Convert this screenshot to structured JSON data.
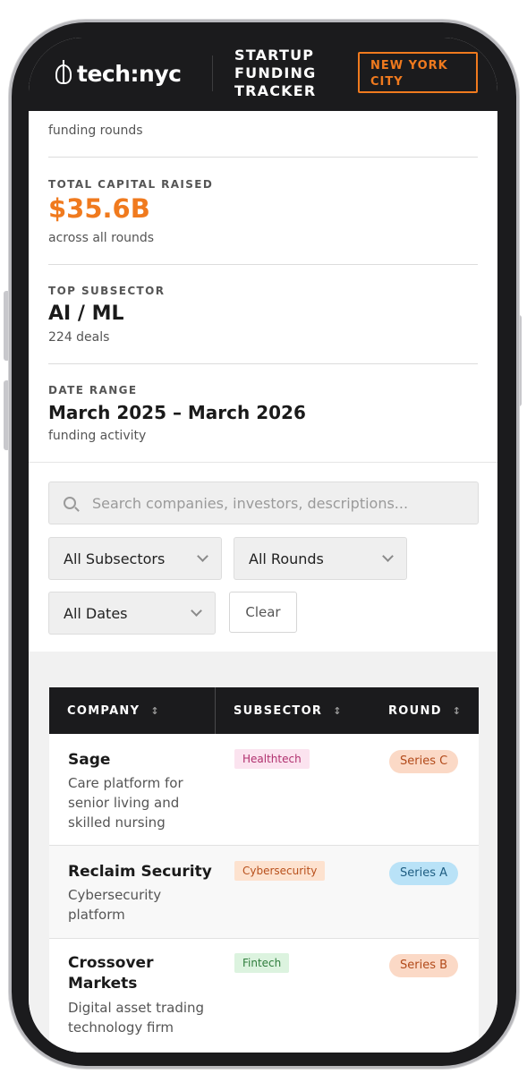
{
  "header": {
    "logo_text": "tech:nyc",
    "title": "STARTUP FUNDING TRACKER",
    "city": "NEW YORK CITY"
  },
  "stats": {
    "rounds": {
      "sub": "funding rounds"
    },
    "capital": {
      "label": "TOTAL CAPITAL RAISED",
      "value": "$35.6B",
      "sub": "across all rounds",
      "color": "#f07a1e"
    },
    "subsector": {
      "label": "TOP SUBSECTOR",
      "value": "AI / ML",
      "sub": "224 deals"
    },
    "dates": {
      "label": "DATE RANGE",
      "value": "March 2025 – March 2026",
      "sub": "funding activity"
    }
  },
  "filters": {
    "search_placeholder": "Search companies, investors, descriptions...",
    "subsector": "All Subsectors",
    "round": "All Rounds",
    "dates": "All Dates",
    "clear": "Clear"
  },
  "table": {
    "columns": [
      "COMPANY",
      "SUBSECTOR",
      "ROUND"
    ],
    "sort_glyph": "↕",
    "rows": [
      {
        "company": "Sage",
        "description": "Care platform for senior living and skilled nursing",
        "subsector": "Healthtech",
        "round": "Series C"
      },
      {
        "company": "Reclaim Security",
        "description": "Cybersecurity platform",
        "subsector": "Cybersecurity",
        "round": "Series A"
      },
      {
        "company": "Crossover Markets",
        "description": "Digital asset trading technology firm",
        "subsector": "Fintech",
        "round": "Series B"
      }
    ]
  },
  "colors": {
    "accent": "#f07a1e",
    "header_bg": "#1b1b1d",
    "healthtech_bg": "#fbe3ef",
    "healthtech_fg": "#b0306e",
    "cyber_bg": "#fde2cf",
    "cyber_fg": "#b8501c",
    "fintech_bg": "#dcf3df",
    "fintech_fg": "#2f7d3c",
    "seriesC_bg": "#fbd9c6",
    "seriesC_fg": "#b24a1a",
    "seriesA_bg": "#b9e2f7",
    "seriesA_fg": "#1e5d82",
    "seriesB_bg": "#fbd9c6",
    "seriesB_fg": "#b24a1a"
  }
}
